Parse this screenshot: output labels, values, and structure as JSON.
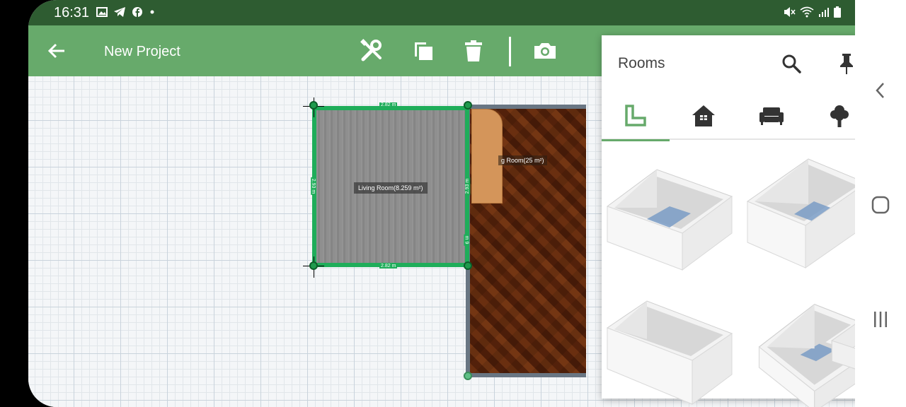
{
  "status_bar": {
    "time": "16:31"
  },
  "appbar": {
    "title": "New Project"
  },
  "floor_plan": {
    "living_room_label": "Living Room(8.259 m²)",
    "wood_room_label": "g Room(25 m²)",
    "dim_top": "2.82 m",
    "dim_bottom": "2.82 m",
    "dim_left": "2.93 m",
    "dim_right": "2.93 m",
    "dim_right_lower": "m 9"
  },
  "rooms_panel": {
    "title": "Rooms",
    "tabs": [
      "room-shape",
      "house",
      "furniture",
      "outdoor"
    ],
    "active_tab": 0
  },
  "colors": {
    "status_bar": "#2e5c31",
    "app_bar": "#67aa6b",
    "room_outline": "#1fad5a"
  }
}
